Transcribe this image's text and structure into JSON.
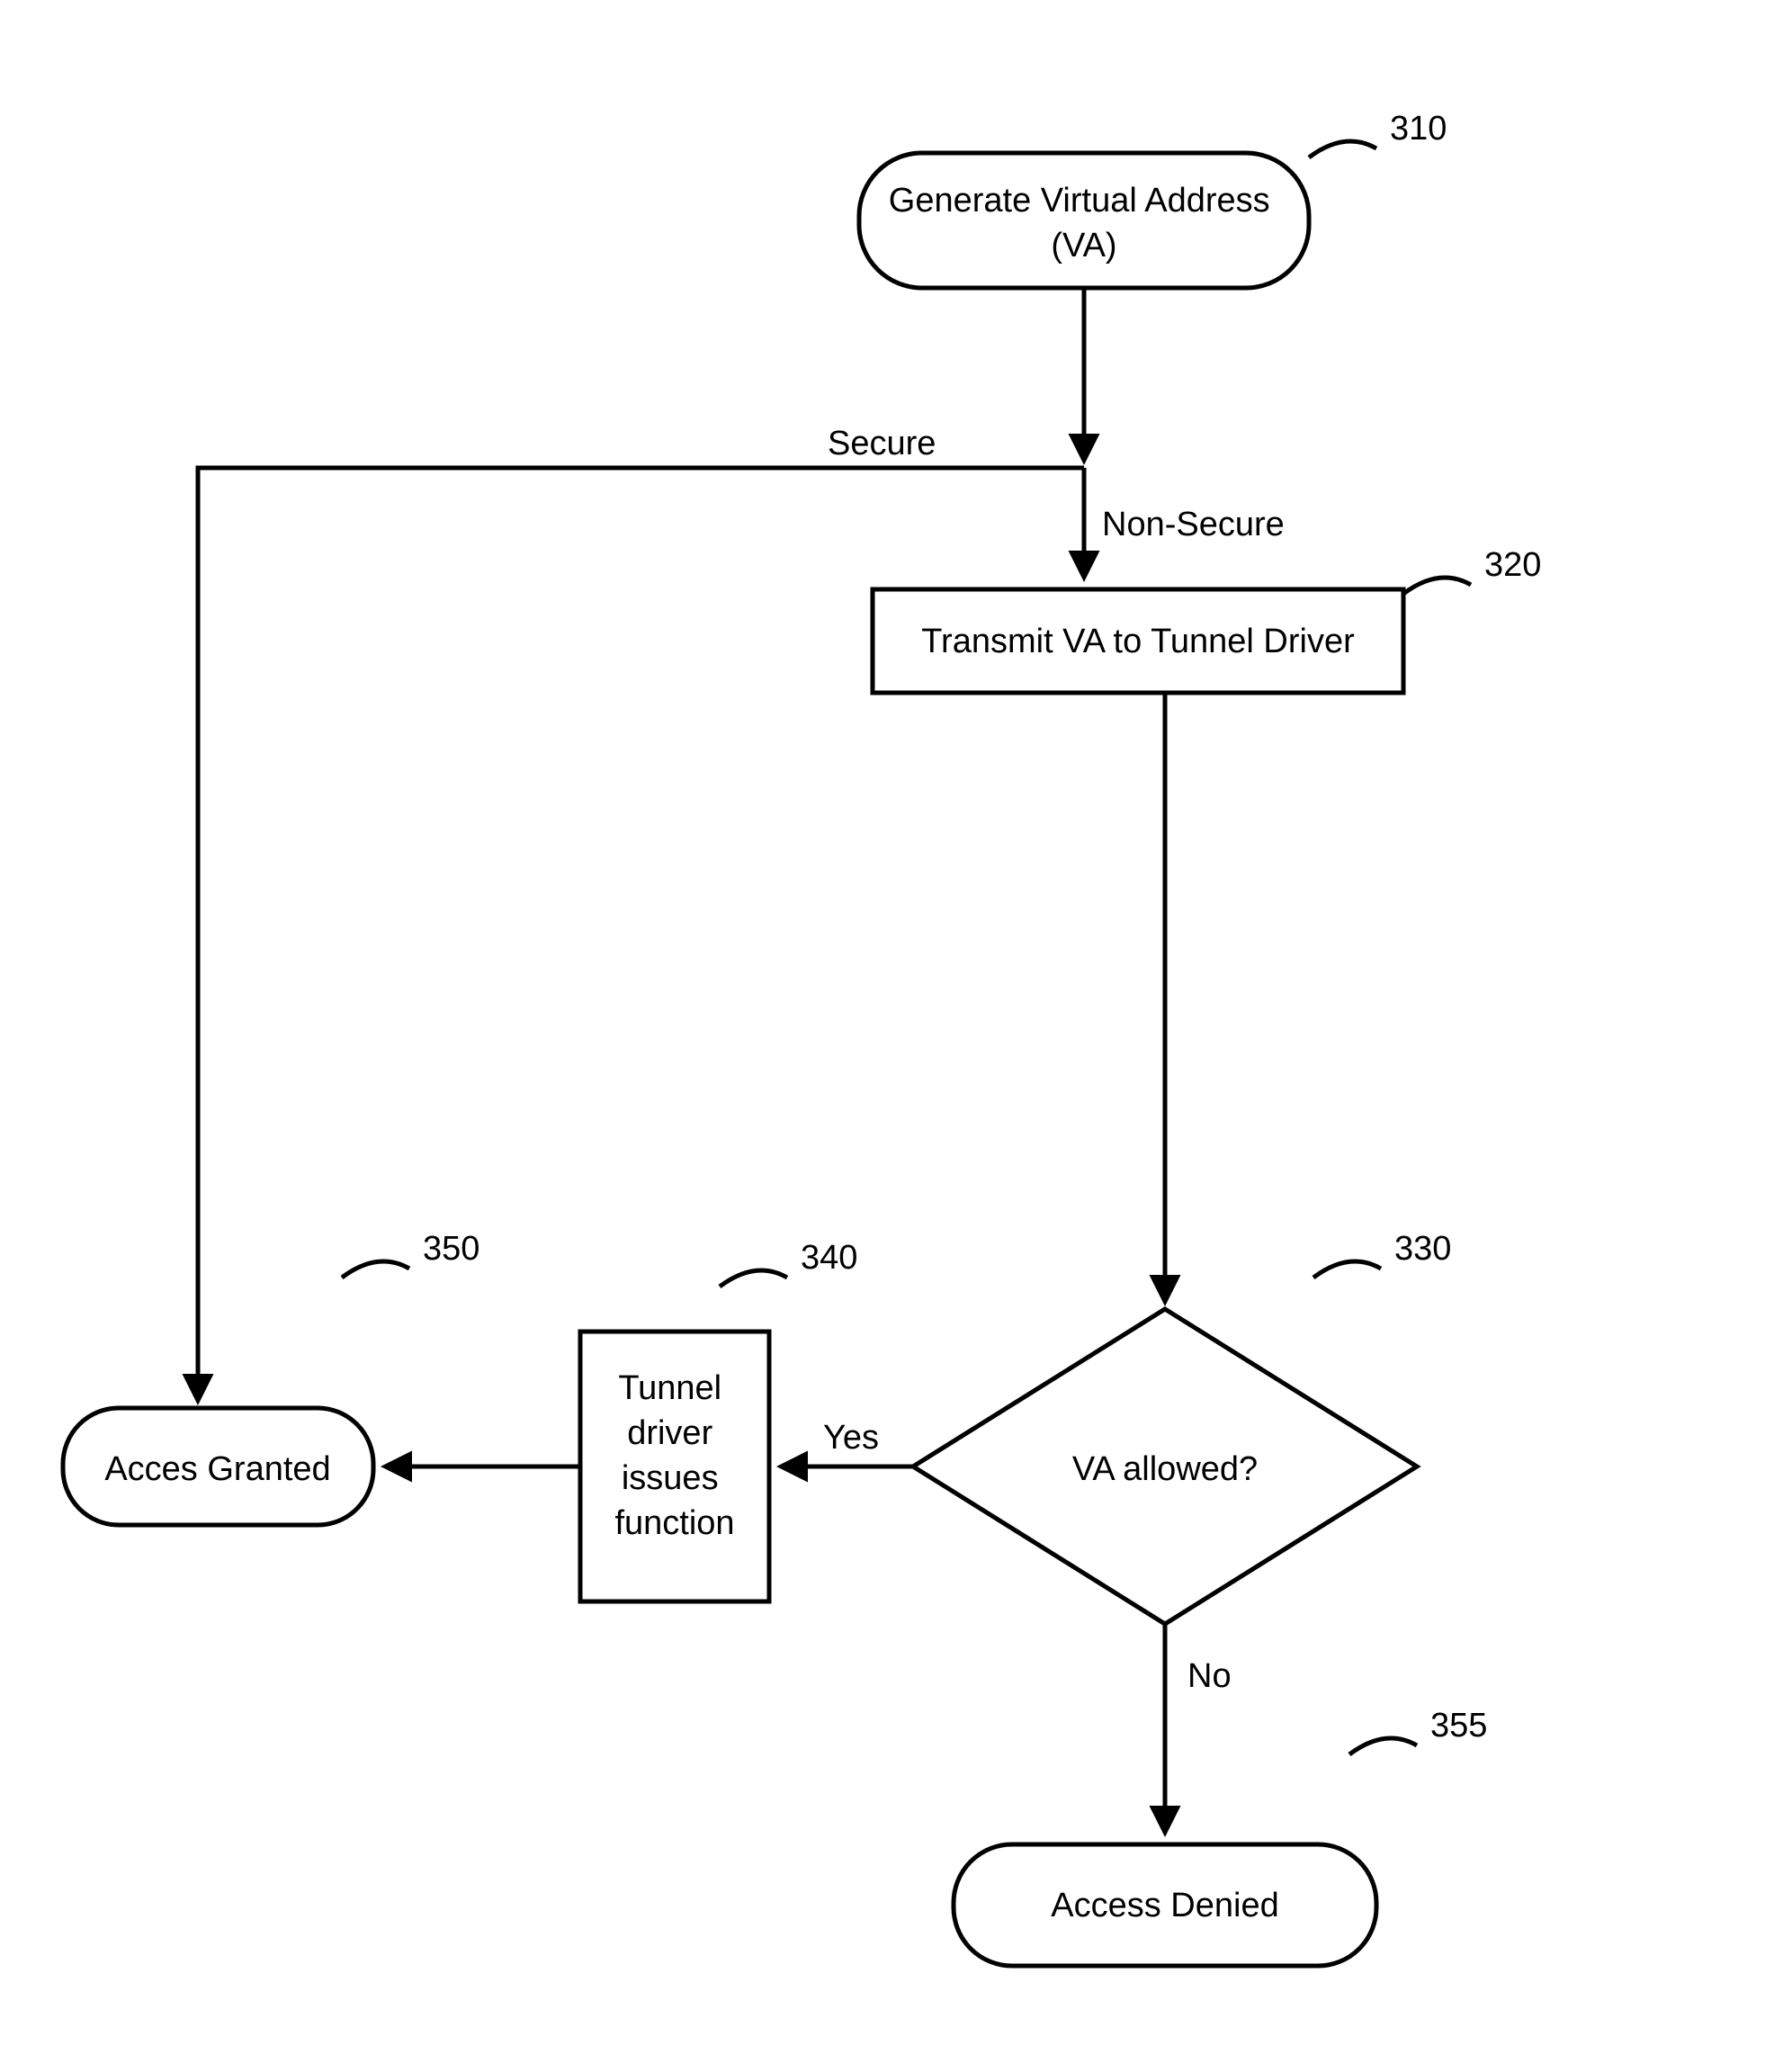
{
  "nodes": {
    "n310": {
      "line1": "Generate Virtual Address",
      "line2": "(VA)",
      "ref": "310"
    },
    "n320": {
      "text": "Transmit VA to Tunnel Driver",
      "ref": "320"
    },
    "n330": {
      "text": "VA allowed?",
      "ref": "330"
    },
    "n340": {
      "line1": "Tunnel",
      "line2": "driver",
      "line3": "issues",
      "line4": "function",
      "ref": "340"
    },
    "n350": {
      "text": "Acces Granted",
      "ref": "350"
    },
    "n355": {
      "text": "Access Denied",
      "ref": "355"
    }
  },
  "edges": {
    "secure": "Secure",
    "nonsecure": "Non-Secure",
    "yes": "Yes",
    "no": "No"
  }
}
